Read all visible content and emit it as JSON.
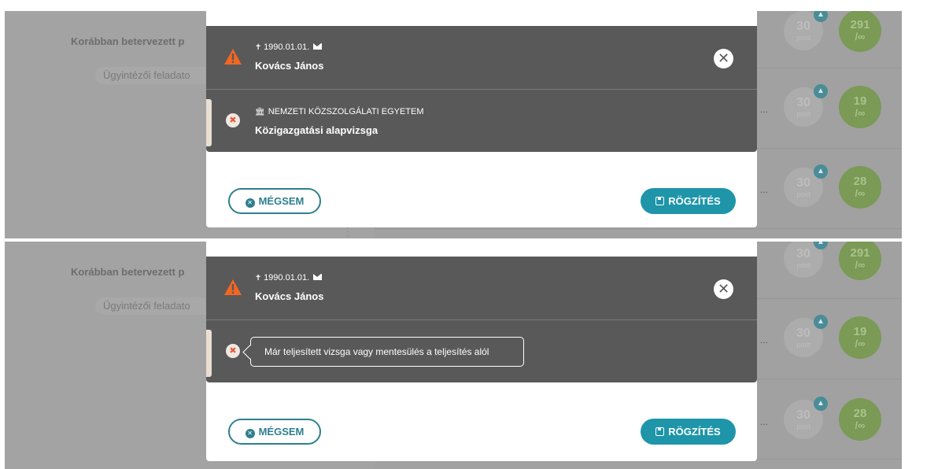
{
  "background": {
    "section_title": "Korábban betervezett p",
    "task_label": "Ügyintézői feladato",
    "ellipsis": "...",
    "points": [
      {
        "value": "30",
        "label": "pont"
      },
      {
        "value": "30",
        "label": "pont"
      },
      {
        "value": "30",
        "label": "pont"
      }
    ],
    "counters": [
      {
        "value": "291",
        "limit": "/∞"
      },
      {
        "value": "19",
        "limit": "/∞"
      },
      {
        "value": "28",
        "limit": "/∞"
      }
    ]
  },
  "person": {
    "birth_date": "1990.01.01.",
    "name": "Kovács János"
  },
  "exam": {
    "institution": "NEMZETI KÖZSZOLGÁLATI EGYETEM",
    "name": "Közigazgatási alapvizsga"
  },
  "tooltip": {
    "text": "Már teljesített vizsga vagy mentesülés a teljesítés alól"
  },
  "buttons": {
    "cancel_label": "MÉGSEM",
    "save_label": "RÖGZÍTÉS"
  },
  "colors": {
    "accent": "#1e95a9",
    "dark_bar": "#595959",
    "warning": "#f26722",
    "error": "#ea5a3c",
    "counter_green": "#7a9a55"
  },
  "icons": {
    "warning": "warning-triangle-icon",
    "close": "close-circle-icon",
    "remove": "x-circle-icon",
    "institution": "building-icon",
    "birth": "person-icon",
    "email": "envelope-icon",
    "cancel": "cancel-icon",
    "save": "floppy-disk-icon",
    "points": "graduation-cap-icon"
  }
}
